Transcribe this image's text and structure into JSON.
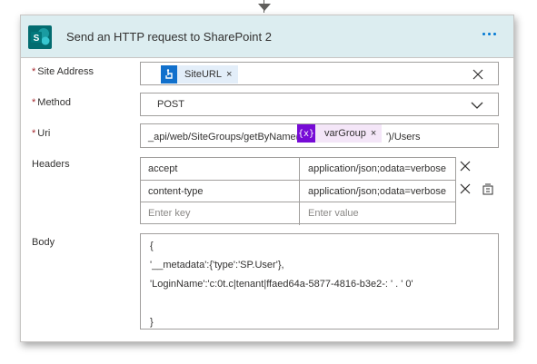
{
  "action": {
    "title": "Send an HTTP request to SharePoint 2"
  },
  "fields": {
    "site_address": {
      "label": "Site Address",
      "required_mark": "*",
      "token_label": "SiteURL",
      "token_close": "×"
    },
    "method": {
      "label": "Method",
      "required_mark": "*",
      "value": "POST"
    },
    "uri": {
      "label": "Uri",
      "required_mark": "*",
      "prefix": "_api/web/SiteGroups/getByName('",
      "token_icon_text": "{x}",
      "token_label": "varGroup",
      "token_close": "×",
      "suffix": "')/Users"
    },
    "headers": {
      "label": "Headers",
      "rows": [
        {
          "key": "accept",
          "value": "application/json;odata=verbose"
        },
        {
          "key": "content-type",
          "value": "application/json;odata=verbose"
        }
      ],
      "key_placeholder": "Enter key",
      "value_placeholder": "Enter value"
    },
    "body": {
      "label": "Body",
      "lines": [
        "{",
        "'__metadata':{'type':'SP.User'},",
        "'LoginName':'c:0t.c|tenant|ffaed64a-5877-4816-b3e2-:  '    .    '    0'",
        "",
        "}"
      ]
    }
  },
  "colors": {
    "header_bg": "#dcedf0",
    "sharepoint_green": "#036c70",
    "sharepoint_teal": "#1a9ba1",
    "siteurl_token_bg": "#e3eef9",
    "siteurl_icon_bg": "#1170cc",
    "var_token_bg": "#f4e6f8",
    "var_icon_bg": "#770bd6",
    "more_dots": "#0078d4",
    "required": "#a4262c"
  }
}
